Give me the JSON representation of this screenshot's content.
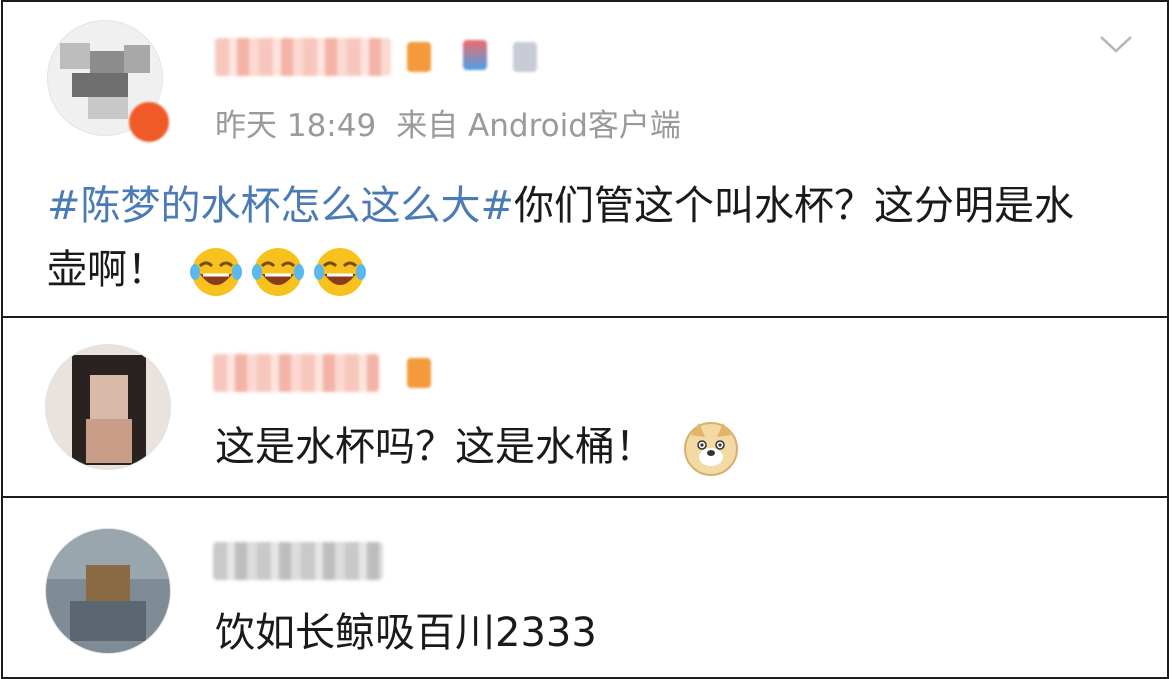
{
  "post": {
    "time": "昨天 18:49",
    "source": "来自 Android客户端",
    "hashtag": "#陈梦的水杯怎么这么大#",
    "text": "你们管这个叫水杯？这分明是水壶啊！",
    "emojis": [
      "laughing-tears",
      "laughing-tears",
      "laughing-tears"
    ]
  },
  "replies": [
    {
      "text": "这是水杯吗？这是水桶！",
      "emoji": "doge"
    },
    {
      "text": "饮如长鲸吸百川2333"
    }
  ],
  "colors": {
    "hashtag": "#4a7bb7",
    "meta": "#9a9a9a",
    "text": "#1a1a1a"
  }
}
